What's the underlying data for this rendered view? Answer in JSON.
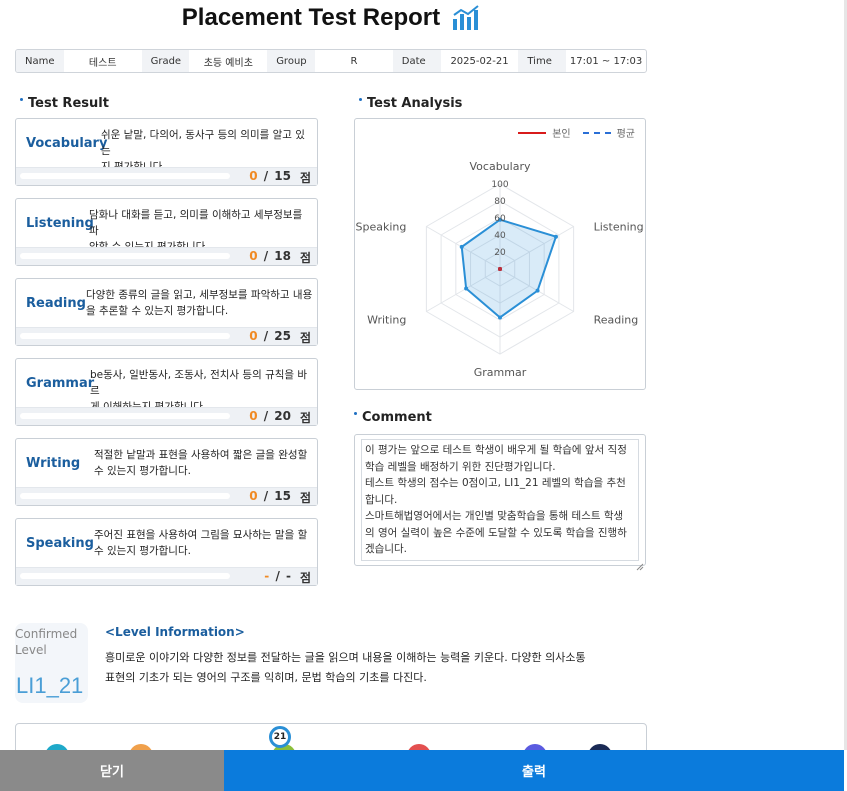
{
  "header": {
    "title": "Placement Test Report",
    "icon": "bar-chart-icon"
  },
  "info": {
    "name_label": "Name",
    "name_value": "테스트",
    "grade_label": "Grade",
    "grade_value": "초등 예비초",
    "group_label": "Group",
    "group_value": "R",
    "date_label": "Date",
    "date_value": "2025-02-21",
    "time_label": "Time",
    "time_value": "17:01 ~ 17:03"
  },
  "test_result": {
    "heading": "Test Result",
    "unit": "점",
    "items": [
      {
        "name": "Vocabulary",
        "desc1": "쉬운 낱말, 다의어, 동사구 등의 의미를 알고 있는",
        "desc2": "지 평가합니다.",
        "score": "0",
        "total": "15",
        "fraction": 0
      },
      {
        "name": "Listening",
        "desc1": "담화나 대화를 듣고, 의미를 이해하고 세부정보를 파",
        "desc2": "악할 수 있는지 평가합니다.",
        "score": "0",
        "total": "18",
        "fraction": 0
      },
      {
        "name": "Reading",
        "desc1": "다양한 종류의 글을 읽고, 세부정보를 파악하고 내용",
        "desc2": "을 추론할 수 있는지 평가합니다.",
        "score": "0",
        "total": "25",
        "fraction": 0
      },
      {
        "name": "Grammar",
        "desc1": "be동사, 일반동사, 조동사, 전치사 등의 규칙을 바르",
        "desc2": "게 이해하는지 평가합니다.",
        "score": "0",
        "total": "20",
        "fraction": 0
      },
      {
        "name": "Writing",
        "desc1": "적절한 낱말과 표현을 사용하여 짧은 글을 완성할",
        "desc2": "수 있는지 평가합니다.",
        "score": "0",
        "total": "15",
        "fraction": 0
      },
      {
        "name": "Speaking",
        "desc1": "주어진 표현을 사용하여 그림을 묘사하는 말을 할",
        "desc2": "수 있는지 평가합니다.",
        "score": "-",
        "total": "-",
        "fraction": 0
      }
    ]
  },
  "test_analysis": {
    "heading": "Test Analysis",
    "legend_mine": "본인",
    "legend_avg": "평균"
  },
  "chart_data": {
    "type": "radar",
    "axes": [
      "Vocabulary",
      "Listening",
      "Reading",
      "Grammar",
      "Writing",
      "Speaking"
    ],
    "ticks": [
      "20",
      "40",
      "60",
      "80",
      "100"
    ],
    "rlim": [
      0,
      100
    ],
    "series": [
      {
        "name": "본인",
        "values": [
          0,
          0,
          0,
          0,
          0,
          0
        ],
        "color": "#d81b1b"
      },
      {
        "name": "평균",
        "values": [
          58,
          76,
          51,
          57,
          46,
          52
        ],
        "color": "#2a8fd6"
      }
    ]
  },
  "comment": {
    "heading": "Comment",
    "text": "이 평가는 앞으로 테스트 학생이 배우게 될 학습에 앞서 직정\n학습 레벨을 배정하기 위한 진단평가입니다.\n테스트 학생의 점수는 0점이고, LI1_21 레벨의 학습을 추천\n합니다.\n스마트해법영어에서는 개인별 맞춤학습을 통해 테스트 학생\n의 영어 실력이 높은 수준에 도달할 수 있도록 학습을 진행하\n겠습니다."
  },
  "level": {
    "confirmed_line1": "Confirmed",
    "confirmed_line2": "Level",
    "code": "LI1_21",
    "info_title": "<Level Information>",
    "info_line1": "흥미로운 이야기와 다양한 정보를 전달하는 글을 읽으며 내용을 이해하는 능력을 키운다. 다양한 의사소통",
    "info_line2": "표현의 기초가 되는 영어의 구조를 익히며, 문법 학습의 기초를 다진다.",
    "current_step": "21"
  },
  "buttons": {
    "close": "닫기",
    "print": "출력"
  },
  "colors": {
    "accent": "#0b7bdc",
    "skill_name": "#1b5e9e",
    "score_highlight": "#f08a24"
  }
}
